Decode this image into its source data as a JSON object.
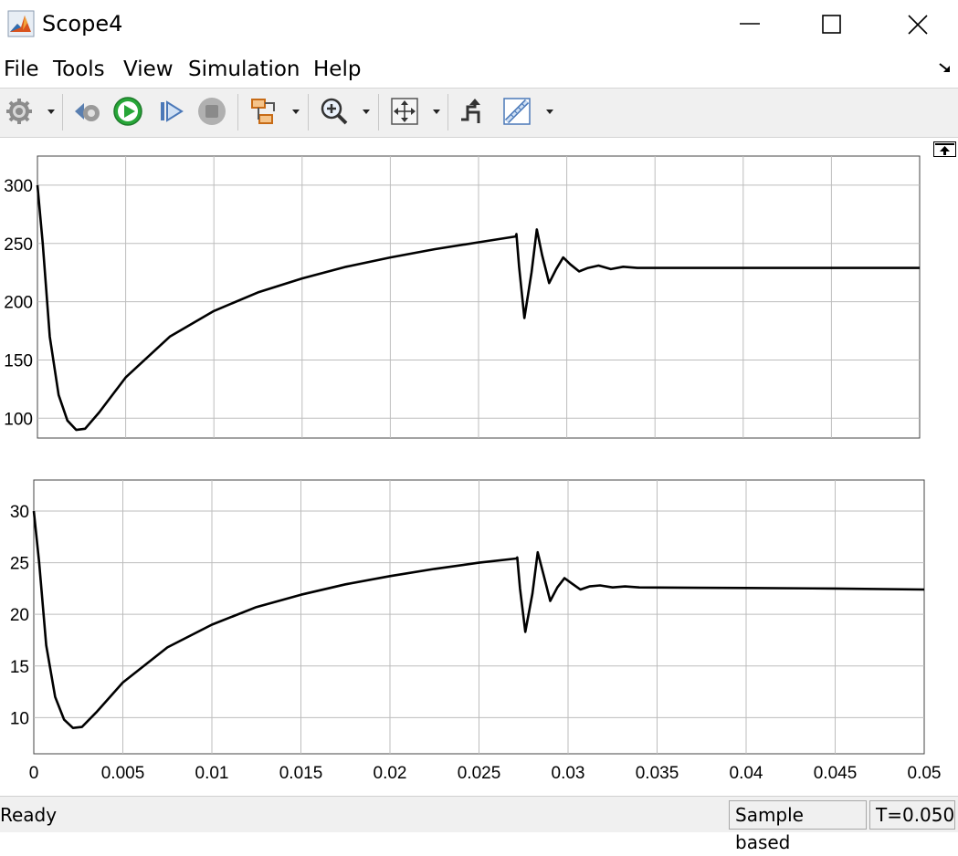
{
  "window": {
    "title": "Scope4"
  },
  "menu": {
    "items": [
      "File",
      "Tools",
      "View",
      "Simulation",
      "Help"
    ]
  },
  "toolbar": {
    "icons": [
      "gear-icon",
      "step-back-icon",
      "run-icon",
      "step-forward-icon",
      "stop-icon",
      "signal-selector-icon",
      "zoom-icon",
      "fit-axes-icon",
      "triggers-icon",
      "measurements-icon"
    ]
  },
  "status": {
    "text": "Ready",
    "mode": "Sample based",
    "time": "T=0.050"
  },
  "colors": {
    "trace": "#000000",
    "grid": "#bdbdbd",
    "toolbar_bg": "#f0f0f0",
    "run_green": "#27a638"
  },
  "chart_data": [
    {
      "type": "line",
      "xlim": [
        0,
        0.05
      ],
      "ylim": [
        83,
        325
      ],
      "yticks": [
        "100",
        "150",
        "200",
        "250",
        "300"
      ],
      "yticks_values": [
        100,
        150,
        200,
        250,
        300
      ],
      "xticks_values": [
        0,
        0.005,
        0.01,
        0.015,
        0.02,
        0.025,
        0.03,
        0.035,
        0.04,
        0.045,
        0.05
      ],
      "grid": true,
      "series": [
        {
          "x": [
            0,
            0.0003,
            0.0007,
            0.0012,
            0.0017,
            0.0022,
            0.0027,
            0.0035,
            0.005,
            0.0075,
            0.01,
            0.0125,
            0.015,
            0.0175,
            0.02,
            0.0225,
            0.025,
            0.0271,
            0.02715,
            0.0273,
            0.0276,
            0.028,
            0.0283,
            0.0286,
            0.029,
            0.0294,
            0.0298,
            0.0302,
            0.0307,
            0.0312,
            0.0318,
            0.0325,
            0.0332,
            0.034,
            0.04,
            0.045,
            0.05
          ],
          "y": [
            300,
            250,
            170,
            120,
            98,
            90,
            91,
            105,
            135,
            170,
            192,
            208,
            220,
            230,
            238,
            245,
            251,
            256,
            258,
            230,
            186,
            225,
            262,
            240,
            216,
            228,
            238,
            232,
            226,
            229,
            231,
            228,
            230,
            229,
            229,
            229,
            229
          ]
        }
      ]
    },
    {
      "type": "line",
      "xlim": [
        0,
        0.05
      ],
      "ylim": [
        6.5,
        33
      ],
      "yticks": [
        "10",
        "15",
        "20",
        "25",
        "30"
      ],
      "yticks_values": [
        10,
        15,
        20,
        25,
        30
      ],
      "xticks": [
        "0",
        "0.005",
        "0.01",
        "0.015",
        "0.02",
        "0.025",
        "0.03",
        "0.035",
        "0.04",
        "0.045",
        "0.05"
      ],
      "xticks_values": [
        0,
        0.005,
        0.01,
        0.015,
        0.02,
        0.025,
        0.03,
        0.035,
        0.04,
        0.045,
        0.05
      ],
      "grid": true,
      "series": [
        {
          "x": [
            0,
            0.0003,
            0.0007,
            0.0012,
            0.0017,
            0.0022,
            0.0027,
            0.0035,
            0.005,
            0.0075,
            0.01,
            0.0125,
            0.015,
            0.0175,
            0.02,
            0.0225,
            0.025,
            0.0271,
            0.02715,
            0.0273,
            0.0276,
            0.028,
            0.0283,
            0.0286,
            0.029,
            0.0294,
            0.0298,
            0.0302,
            0.0307,
            0.0312,
            0.0318,
            0.0325,
            0.0332,
            0.034,
            0.04,
            0.045,
            0.05
          ],
          "y": [
            30,
            25,
            17,
            12,
            9.8,
            9.0,
            9.1,
            10.5,
            13.4,
            16.8,
            19.0,
            20.7,
            21.9,
            22.9,
            23.7,
            24.4,
            25.0,
            25.4,
            25.5,
            22.5,
            18.3,
            22.0,
            26.0,
            24.0,
            21.3,
            22.6,
            23.5,
            23.0,
            22.4,
            22.7,
            22.8,
            22.6,
            22.7,
            22.6,
            22.55,
            22.5,
            22.4
          ]
        }
      ]
    }
  ]
}
